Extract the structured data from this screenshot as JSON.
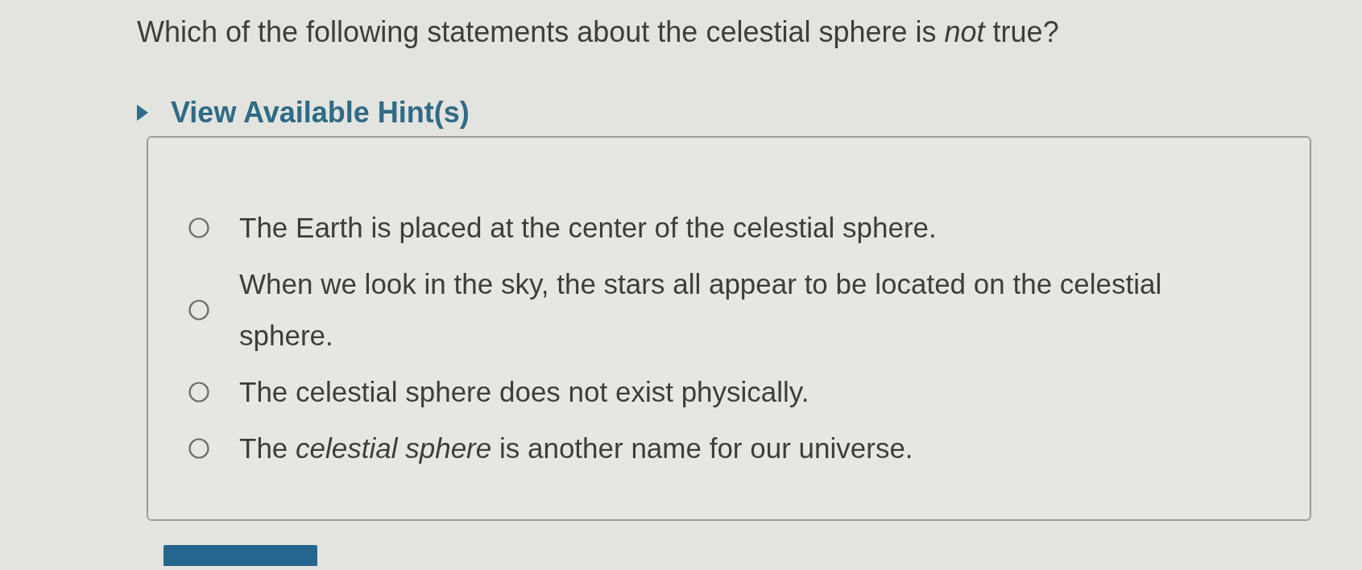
{
  "question": {
    "text": "Which of the following statements about the celestial sphere is *not* true?"
  },
  "hint_toggle": {
    "label": "View Available Hint(s)",
    "expanded": false
  },
  "options": [
    {
      "text": "The Earth is placed at the center of the celestial sphere.",
      "selected": false
    },
    {
      "text": "When we look in the sky, the stars all appear to be located on the celestial sphere.",
      "selected": false
    },
    {
      "text": "The celestial sphere does not exist physically.",
      "selected": false
    },
    {
      "text": "The *celestial sphere* is another name for our universe.",
      "selected": false
    }
  ]
}
